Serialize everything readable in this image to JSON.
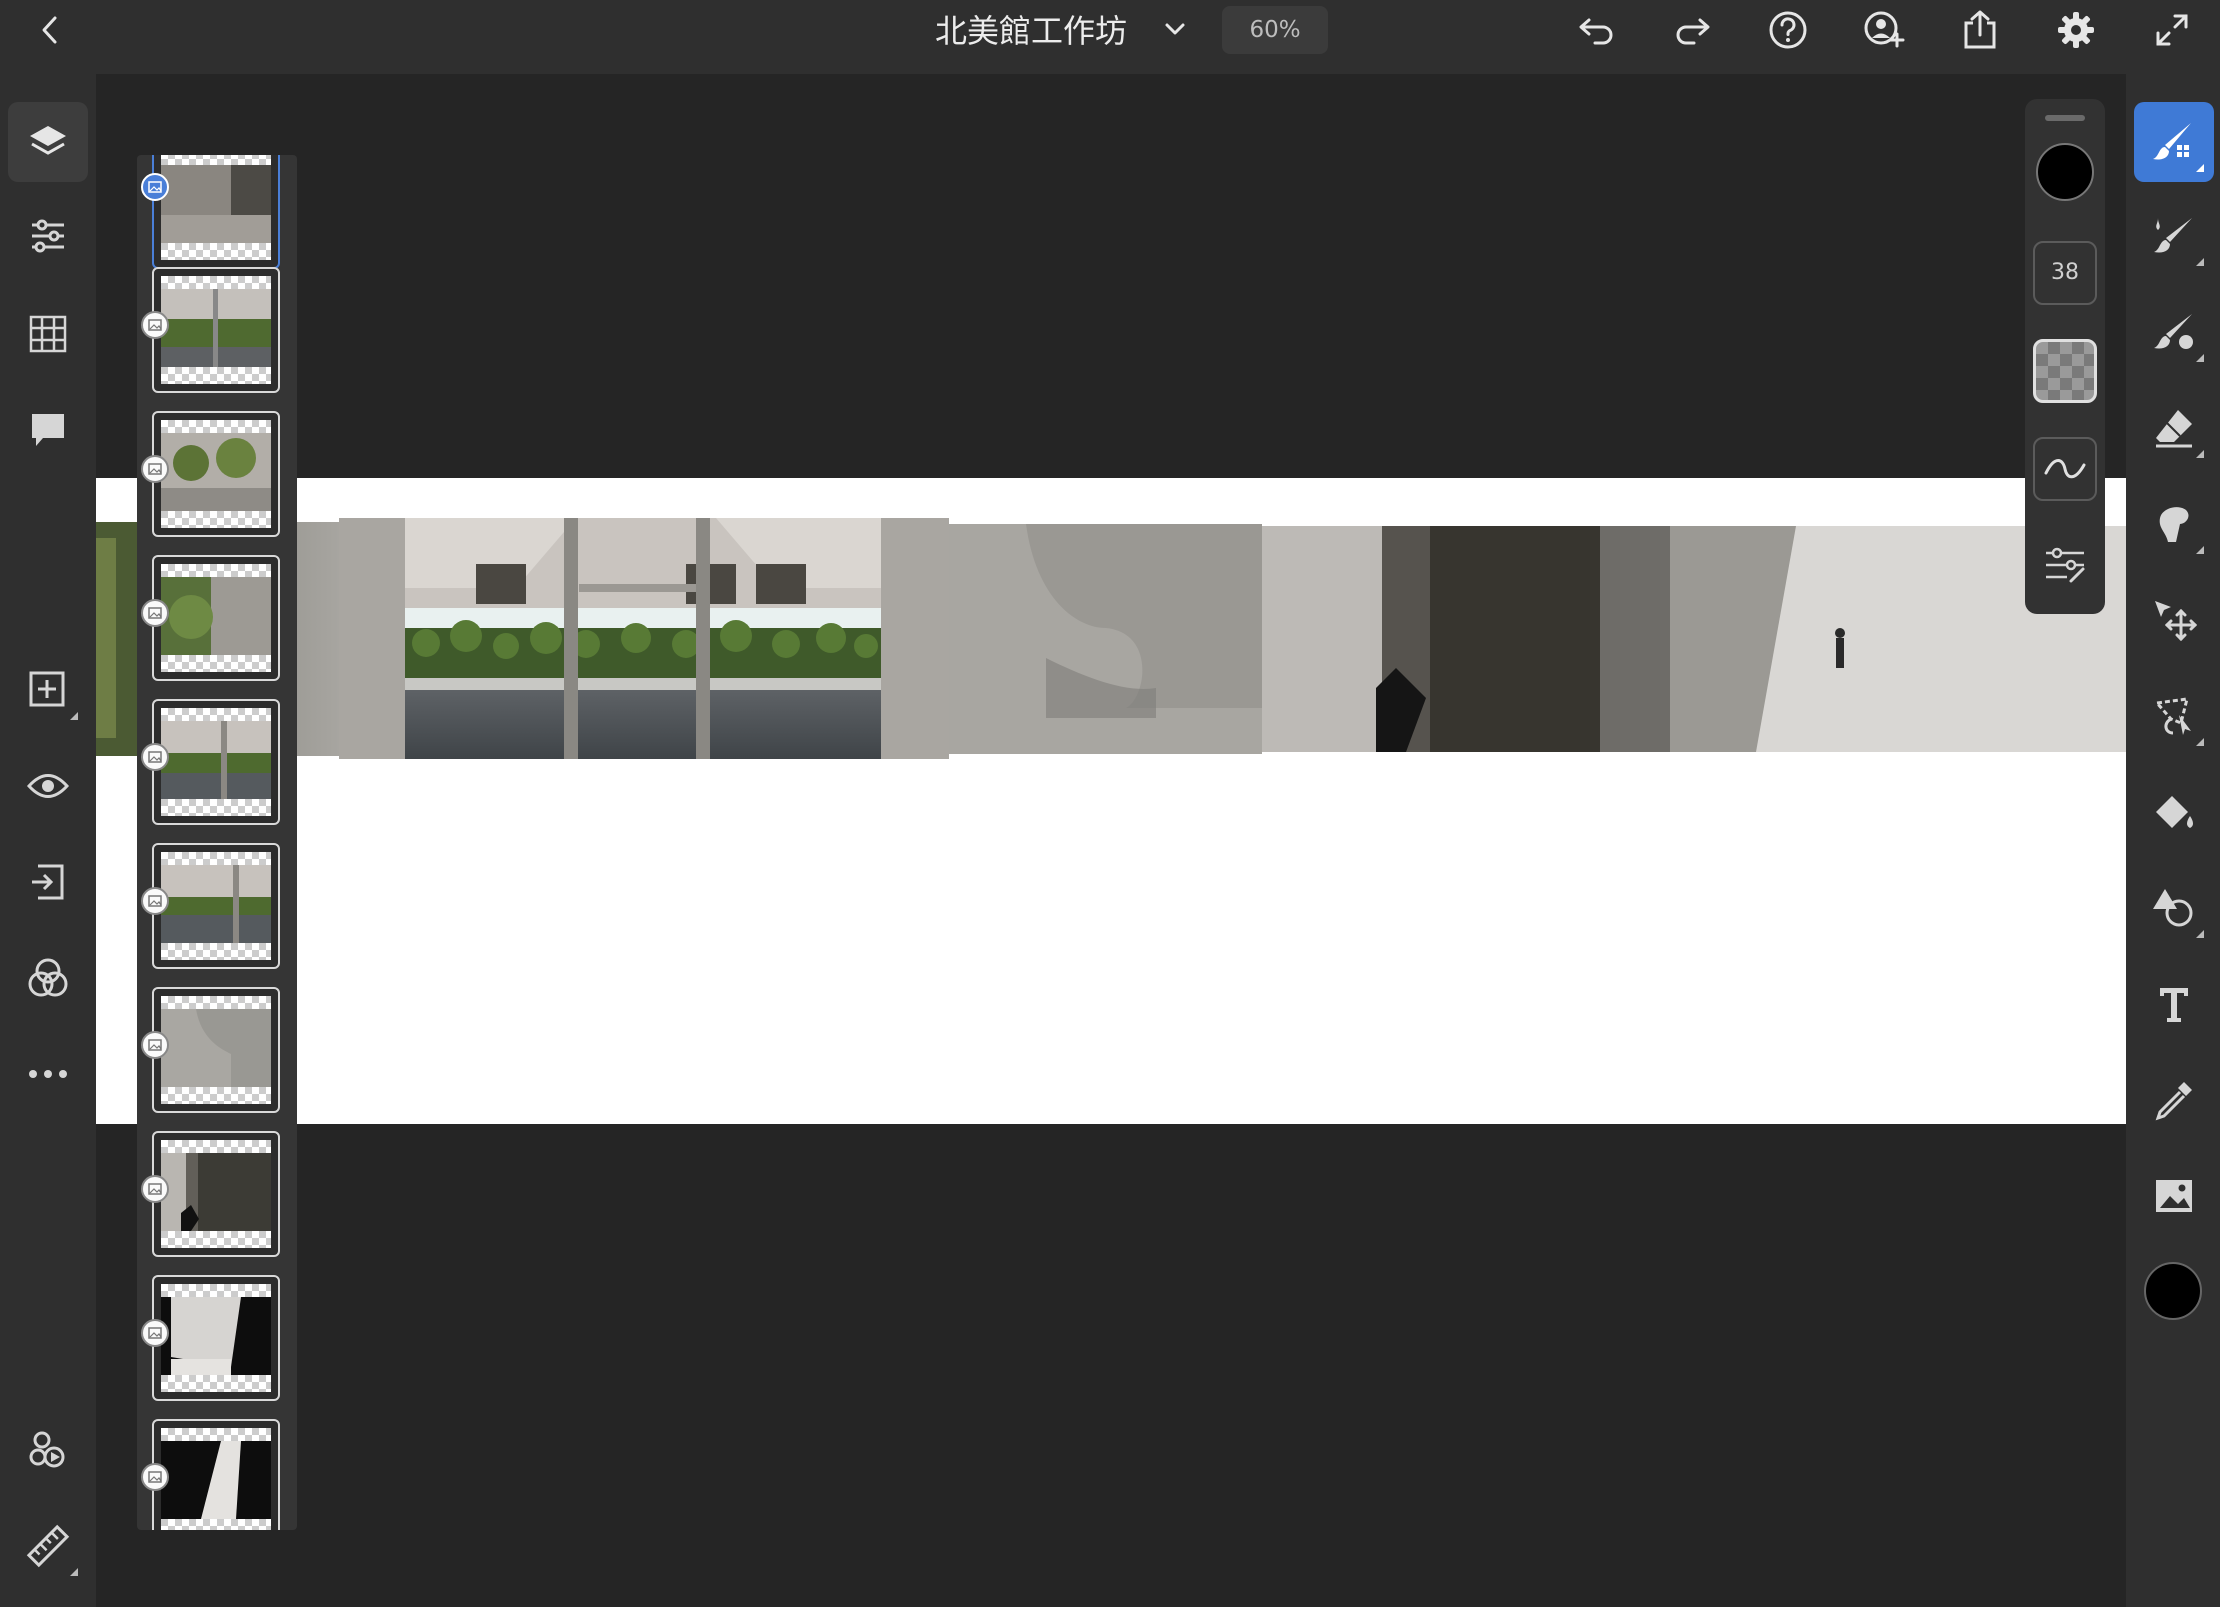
{
  "document": {
    "title": "北美館工作坊",
    "zoom": "60%"
  },
  "topbar": {
    "icons": [
      "back-icon",
      "chevron-down-icon",
      "undo-icon",
      "redo-icon",
      "help-icon",
      "add-user-icon",
      "share-icon",
      "gear-icon",
      "fullscreen-icon"
    ]
  },
  "left_toolbar": {
    "items": [
      "layers-icon",
      "adjustments-icon",
      "grid-icon",
      "comments-icon",
      "add-layer-icon",
      "visibility-icon",
      "mask-icon",
      "blend-icon",
      "more-icon",
      "live-stream-icon",
      "ruler-icon"
    ]
  },
  "layers": {
    "count": 10,
    "selected_index": 0
  },
  "brush_panel": {
    "color": "#000000",
    "size": "38",
    "items": [
      "brush-color-swatch",
      "brush-size",
      "brush-opacity",
      "brush-smoothing",
      "brush-settings-icon"
    ]
  },
  "right_toolbar": {
    "items": [
      "paint-brush-icon",
      "brush-icon",
      "smudge-icon",
      "eraser-icon",
      "liquify-icon",
      "move-icon",
      "lasso-icon",
      "paint-bucket-icon",
      "shape-icon",
      "text-icon",
      "eyedropper-icon",
      "image-icon"
    ],
    "active": "paint-brush-icon",
    "foreground_color": "#000000"
  },
  "colors": {
    "accent": "#3f7ad6",
    "background": "#252525",
    "panel": "#2f2f2f"
  }
}
